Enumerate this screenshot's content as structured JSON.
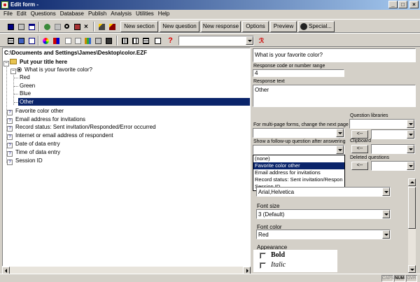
{
  "window": {
    "title": "Edit form -",
    "minimize": "_",
    "maximize": "□",
    "close": "×"
  },
  "menu": [
    "File",
    "Edit",
    "Questions",
    "Database",
    "Publish",
    "Analysis",
    "Utilities",
    "Help"
  ],
  "toolbar": {
    "buttons": [
      "New section",
      "New question",
      "New response",
      "Options",
      "Preview",
      "Special..."
    ],
    "icons": [
      "save-icon",
      "print-icon",
      "window-icon",
      "undo-icon",
      "redo-icon",
      "cut-icon",
      "copy-icon",
      "delete-icon",
      "wand-icon",
      "pen-icon",
      "help-icon"
    ]
  },
  "tree": {
    "path": "C:\\Documents and Settings\\James\\Desktop\\color.EZF",
    "title_node": "Put your title here",
    "question": "What is your favorite color?",
    "responses": [
      "Red",
      "Green",
      "Blue",
      "Other"
    ],
    "selected_response": "Other",
    "items": [
      "Favorite color other",
      "Email address for invitations",
      "Record status: Sent invitation/Responded/Error occurred",
      "Internet or email address of respondent",
      "Date of data entry",
      "Time of data entry",
      "Session ID"
    ]
  },
  "panel": {
    "question_text": "What is your favorite color?",
    "response_code_label": "Response code or number range",
    "response_code": "4",
    "response_text_label": "Response text",
    "response_text": "Other",
    "next_page_label": "For multi-page forms, change the next page",
    "followup_label": "Show a follow-up question after answering",
    "followup_options": [
      "(none)",
      "Favorite color other",
      "Email address for invitations",
      "Record status: Sent invitation/Respon",
      "Session ID"
    ],
    "followup_highlighted": "Favorite color other",
    "question_libraries_label": "Question libraries",
    "clipboard_label": "Clipboard",
    "deleted_questions_label": "Deleted questions",
    "arrow_btn": "<--",
    "font_value": "Arial,Helvetica",
    "font_size_label": "Font size",
    "font_size_value": "3 (Default)",
    "font_color_label": "Font color",
    "font_color_value": "Red",
    "appearance_label": "Appearance",
    "bold_label": "Bold",
    "italic_label": "Italic"
  },
  "status": [
    "CAPS",
    "NUM",
    "OVR"
  ]
}
